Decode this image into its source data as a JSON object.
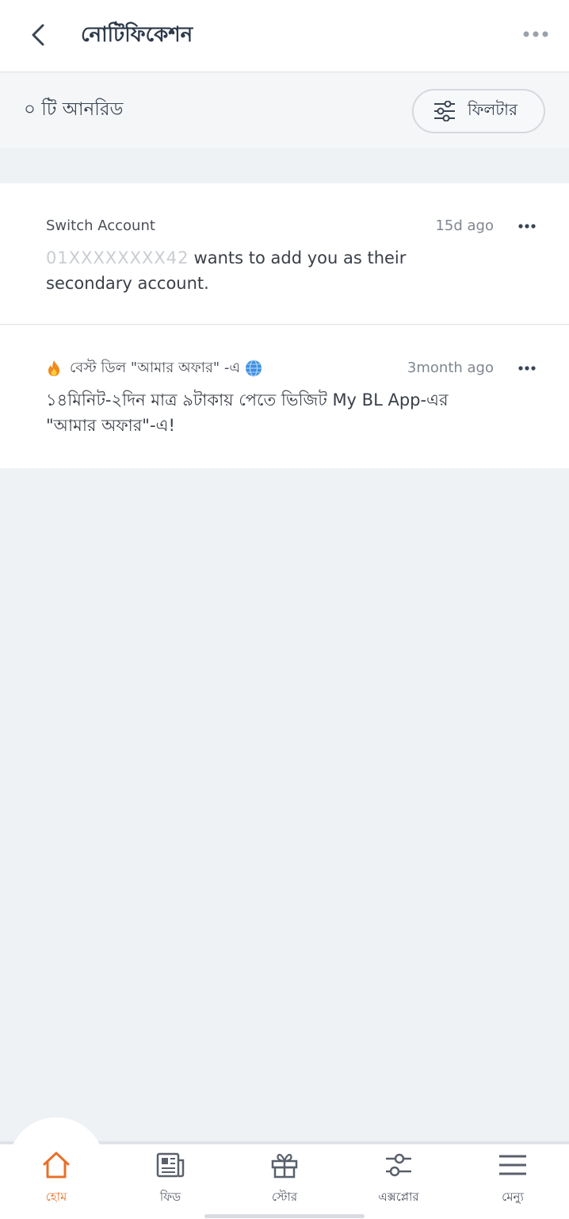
{
  "header": {
    "title": "নোটিফিকেশন"
  },
  "unread": {
    "text": "০ টি আনরিড",
    "filter_label": "ফিলটার"
  },
  "notifications": [
    {
      "source": "Switch Account",
      "time": "15d ago",
      "masked_number": "01XXXXXXXX42",
      "body": "wants to add you as their secondary account."
    },
    {
      "source": "বেস্ট ডিল \"আমার অফার\" -এ",
      "time": "3month ago",
      "body": "১৪মিনিট-২দিন মাত্র ৯টাকায় পেতে ভিজিট My BL App-এর \"আমার অফার\"-এ!"
    }
  ],
  "bottom_nav": {
    "items": [
      {
        "label": "হোম",
        "icon": "home-icon",
        "active": true
      },
      {
        "label": "ফিড",
        "icon": "feed-icon",
        "active": false
      },
      {
        "label": "স্টোর",
        "icon": "store-icon",
        "active": false
      },
      {
        "label": "এক্সপ্লোর",
        "icon": "explore-icon",
        "active": false
      },
      {
        "label": "মেন্যু",
        "icon": "menu-icon",
        "active": false
      }
    ]
  },
  "colors": {
    "accent": "#e7702a",
    "title": "#2e3a4b",
    "background": "#eef2f5"
  }
}
